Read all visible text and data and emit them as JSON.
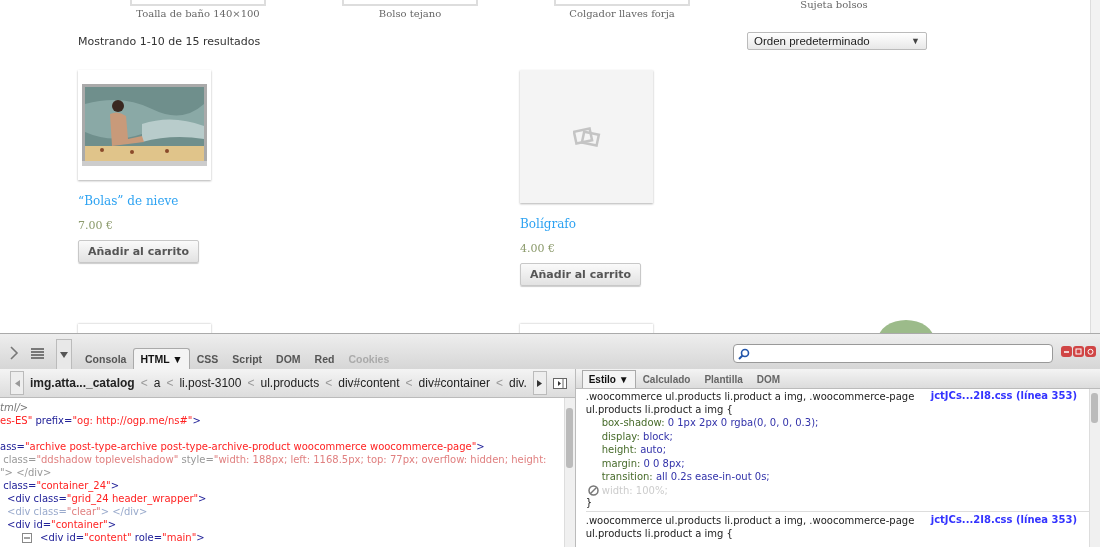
{
  "page": {
    "top_products": [
      {
        "name": "Toalla de baño 140×100",
        "framed": true
      },
      {
        "name": "Bolso tejano",
        "framed": true
      },
      {
        "name": "Colgador llaves forja",
        "framed": true
      },
      {
        "name": "Sujeta bolsos",
        "framed": false
      }
    ],
    "result_count": "Mostrando 1-10 de 15 resultados",
    "sort": {
      "value": "Orden predeterminado",
      "arrow": "▼"
    },
    "products": [
      {
        "title": "“Bolas” de nieve",
        "price": "7.00 €",
        "button": "Añadir al carrito"
      },
      {
        "title": "Bolígrafo",
        "price": "4.00 €",
        "button": "Añadir al carrito",
        "image": {
          "kind": "placeholder"
        }
      }
    ]
  },
  "devtools": {
    "tabs": [
      {
        "label": "Consola",
        "selected": false,
        "disabled": false
      },
      {
        "label": "HTML",
        "selected": true,
        "disabled": false,
        "caret": "▼"
      },
      {
        "label": "CSS",
        "selected": false,
        "disabled": false
      },
      {
        "label": "Script",
        "selected": false,
        "disabled": false
      },
      {
        "label": "DOM",
        "selected": false,
        "disabled": false
      },
      {
        "label": "Red",
        "selected": false,
        "disabled": false
      },
      {
        "label": "Cookies",
        "selected": false,
        "disabled": true
      }
    ],
    "breadcrumbs": [
      {
        "label": "img.atta..._catalog",
        "selected": true
      },
      {
        "separator": "<",
        "label": "a",
        "selected": false
      },
      {
        "separator": "<",
        "label": "li.post-3100",
        "selected": false
      },
      {
        "separator": "<",
        "label": "ul.products",
        "selected": false
      },
      {
        "separator": "<",
        "label": "div#content",
        "selected": false
      },
      {
        "separator": "<",
        "label": "div#container",
        "selected": false
      },
      {
        "separator": "<",
        "label": "div.",
        "selected": false
      }
    ],
    "side_tabs": [
      {
        "label": "Estilo",
        "selected": true,
        "caret": "▼"
      },
      {
        "label": "Calculado",
        "selected": false
      },
      {
        "label": "Plantilla",
        "selected": false
      },
      {
        "label": "DOM",
        "selected": false
      }
    ],
    "html_lines": [
      {
        "segments": [
          {
            "kind": "comment",
            "text": "tml/>"
          }
        ]
      },
      {
        "segments": [
          {
            "kind": "value",
            "text": "es-ES\""
          },
          {
            "kind": "attr",
            "text": " prefix="
          },
          {
            "kind": "value",
            "text": "\"og: http://ogp.me/ns#\""
          },
          {
            "kind": "attr",
            "text": ">"
          }
        ]
      },
      {
        "blank_before": true,
        "segments": [
          {
            "kind": "attr",
            "text": "ass="
          },
          {
            "kind": "value",
            "text": "\"archive post-type-archive post-type-archive-product woocommerce woocommerce-page\""
          },
          {
            "kind": "attr",
            "text": ">"
          }
        ]
      },
      {
        "segments": [
          {
            "kind": "dim",
            "text": " class="
          },
          {
            "kind": "dimvalue",
            "text": "\"ddshadow toplevelshadow\""
          },
          {
            "kind": "dim",
            "text": " style="
          },
          {
            "kind": "dimvalue",
            "text": "\"width: 188px; left: 1168.5px; top: 77px; overflow: hidden; height:"
          }
        ]
      },
      {
        "segments": [
          {
            "kind": "dim",
            "text": "\"> </div>"
          }
        ]
      },
      {
        "segments": [
          {
            "kind": "attr",
            "text": " class="
          },
          {
            "kind": "value",
            "text": "\"container_24\""
          },
          {
            "kind": "attr",
            "text": ">"
          }
        ]
      },
      {
        "segments": [
          {
            "kind": "attr",
            "text": "<div class="
          },
          {
            "kind": "value",
            "text": "\"grid_24 header_wrapper\""
          },
          {
            "kind": "attr",
            "text": ">"
          }
        ]
      },
      {
        "segments": [
          {
            "kind": "dimtag",
            "text": "<div class="
          },
          {
            "kind": "dimvalue",
            "text": "\"clear\""
          },
          {
            "kind": "dimtag",
            "text": "> </div>"
          }
        ]
      },
      {
        "segments": [
          {
            "kind": "attr",
            "text": "<div id="
          },
          {
            "kind": "value",
            "text": "\"container\""
          },
          {
            "kind": "attr",
            "text": ">"
          }
        ]
      },
      {
        "expandable": true,
        "segments": [
          {
            "kind": "attr",
            "text": "<div id="
          },
          {
            "kind": "value",
            "text": "\"content\""
          },
          {
            "kind": "attr",
            "text": " role="
          },
          {
            "kind": "value",
            "text": "\"main\""
          },
          {
            "kind": "attr",
            "text": ">"
          }
        ]
      }
    ],
    "css_rules": [
      {
        "selector": ".woocommerce ul.products li.product a img, .woocommerce-page ul.products li.product a img {",
        "source": "jctJCs...2I8.css (línea 353)",
        "close": "}",
        "properties": [
          {
            "name": "box-shadow:",
            "value": "0 1px 2px 0 rgba(0, 0, 0, 0.3);",
            "disabled": false
          },
          {
            "name": "display:",
            "value": "block;",
            "disabled": false
          },
          {
            "name": "height:",
            "value": "auto;",
            "disabled": false
          },
          {
            "name": "margin:",
            "value": "0 0 8px;",
            "disabled": false
          },
          {
            "name": "transition:",
            "value": "all 0.2s ease-in-out 0s;",
            "disabled": false
          },
          {
            "name": "width:",
            "value": "100%;",
            "disabled": true
          }
        ]
      },
      {
        "selector": ".woocommerce ul.products li.product a img, .woocommerce-page ul.products li.product a img {",
        "source": "jctJCs...2I8.css (línea 353)"
      }
    ]
  }
}
